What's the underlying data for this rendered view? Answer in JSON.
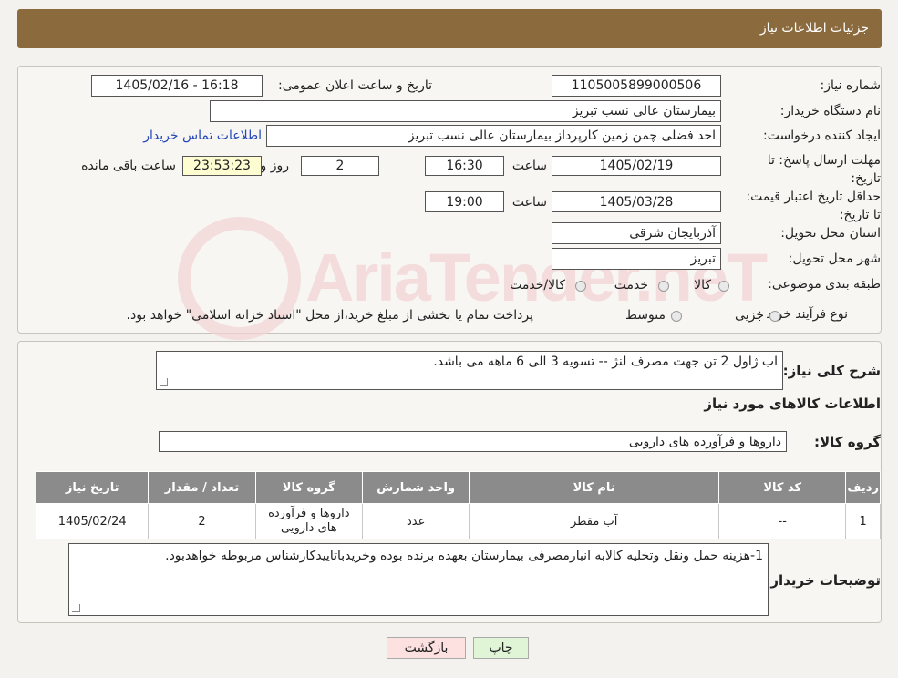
{
  "header": {
    "title": "جزئیات اطلاعات نیاز"
  },
  "form": {
    "need_number_label": "شماره نیاز:",
    "need_number": "1105005899000506",
    "announce_label": "تاریخ و ساعت اعلان عمومی:",
    "announce_value": "1405/02/16 - 16:18",
    "buyer_org_label": "نام دستگاه خریدار:",
    "buyer_org": "بیمارستان عالی نسب تبریز",
    "requester_label": "ایجاد کننده درخواست:",
    "requester": "احد فضلی چمن زمین کارپرداز  بیمارستان عالی نسب تبریز",
    "buyer_contact_link": "اطلاعات تماس خریدار",
    "reply_deadline_label": "مهلت ارسال پاسخ: تا تاریخ:",
    "reply_date": "1405/02/19",
    "hour_label": "ساعت",
    "reply_time": "16:30",
    "remaining_days": "2",
    "days_label": "روز و",
    "remaining_time": "23:53:23",
    "remaining_label": "ساعت باقی مانده",
    "price_validity_label": "حداقل تاریخ اعتبار قیمت: تا تاریخ:",
    "validity_date": "1405/03/28",
    "validity_time": "19:00",
    "province_label": "استان محل تحویل:",
    "province": "آذربایجان شرقی",
    "city_label": "شهر محل تحویل:",
    "city": "تبریز",
    "category_label": "طبقه بندی موضوعی:",
    "category_options": [
      "کالا",
      "خدمت",
      "کالا/خدمت"
    ],
    "purchase_type_label": "نوع فرآیند خرید :",
    "purchase_options": [
      "جزیی",
      "متوسط"
    ],
    "purchase_note": "پرداخت تمام یا بخشی از مبلغ خرید،از محل \"اسناد خزانه اسلامی\" خواهد بود."
  },
  "summary": {
    "label": "شرح کلی نیاز:",
    "text": "اب ژاول 2 تن جهت مصرف لنژ -- تسویه 3 الی 6 ماهه می باشد."
  },
  "goods": {
    "section_title": "اطلاعات کالاهای مورد نیاز",
    "group_label": "گروه کالا:",
    "group_value": "داروها و فرآورده های دارویی",
    "columns": [
      "ردیف",
      "کد کالا",
      "نام کالا",
      "واحد شمارش",
      "گروه کالا",
      "تعداد / مقدار",
      "تاریخ نیاز"
    ],
    "rows": [
      {
        "row": "1",
        "code": "--",
        "name": "آب مقطر",
        "unit": "عدد",
        "group": "داروها و فرآورده های دارویی",
        "qty": "2",
        "date": "1405/02/24"
      }
    ]
  },
  "buyer_notes": {
    "label": "توضیحات خریدار:",
    "text": "1-هزینه حمل ونقل وتخلیه کالابه انبارمصرفی بیمارستان بعهده برنده بوده وخریدباتاییدکارشناس مربوطه خواهدبود."
  },
  "buttons": {
    "print": "چاپ",
    "back": "بازگشت"
  },
  "watermark": "AriaTender.neT",
  "colors": {
    "header": "#8b6a3e",
    "table_header": "#8b8b8b",
    "link": "#2348b9",
    "timer_bg": "#fefdd2",
    "back_btn": "#fde0e0",
    "print_btn": "#dff5d5"
  }
}
